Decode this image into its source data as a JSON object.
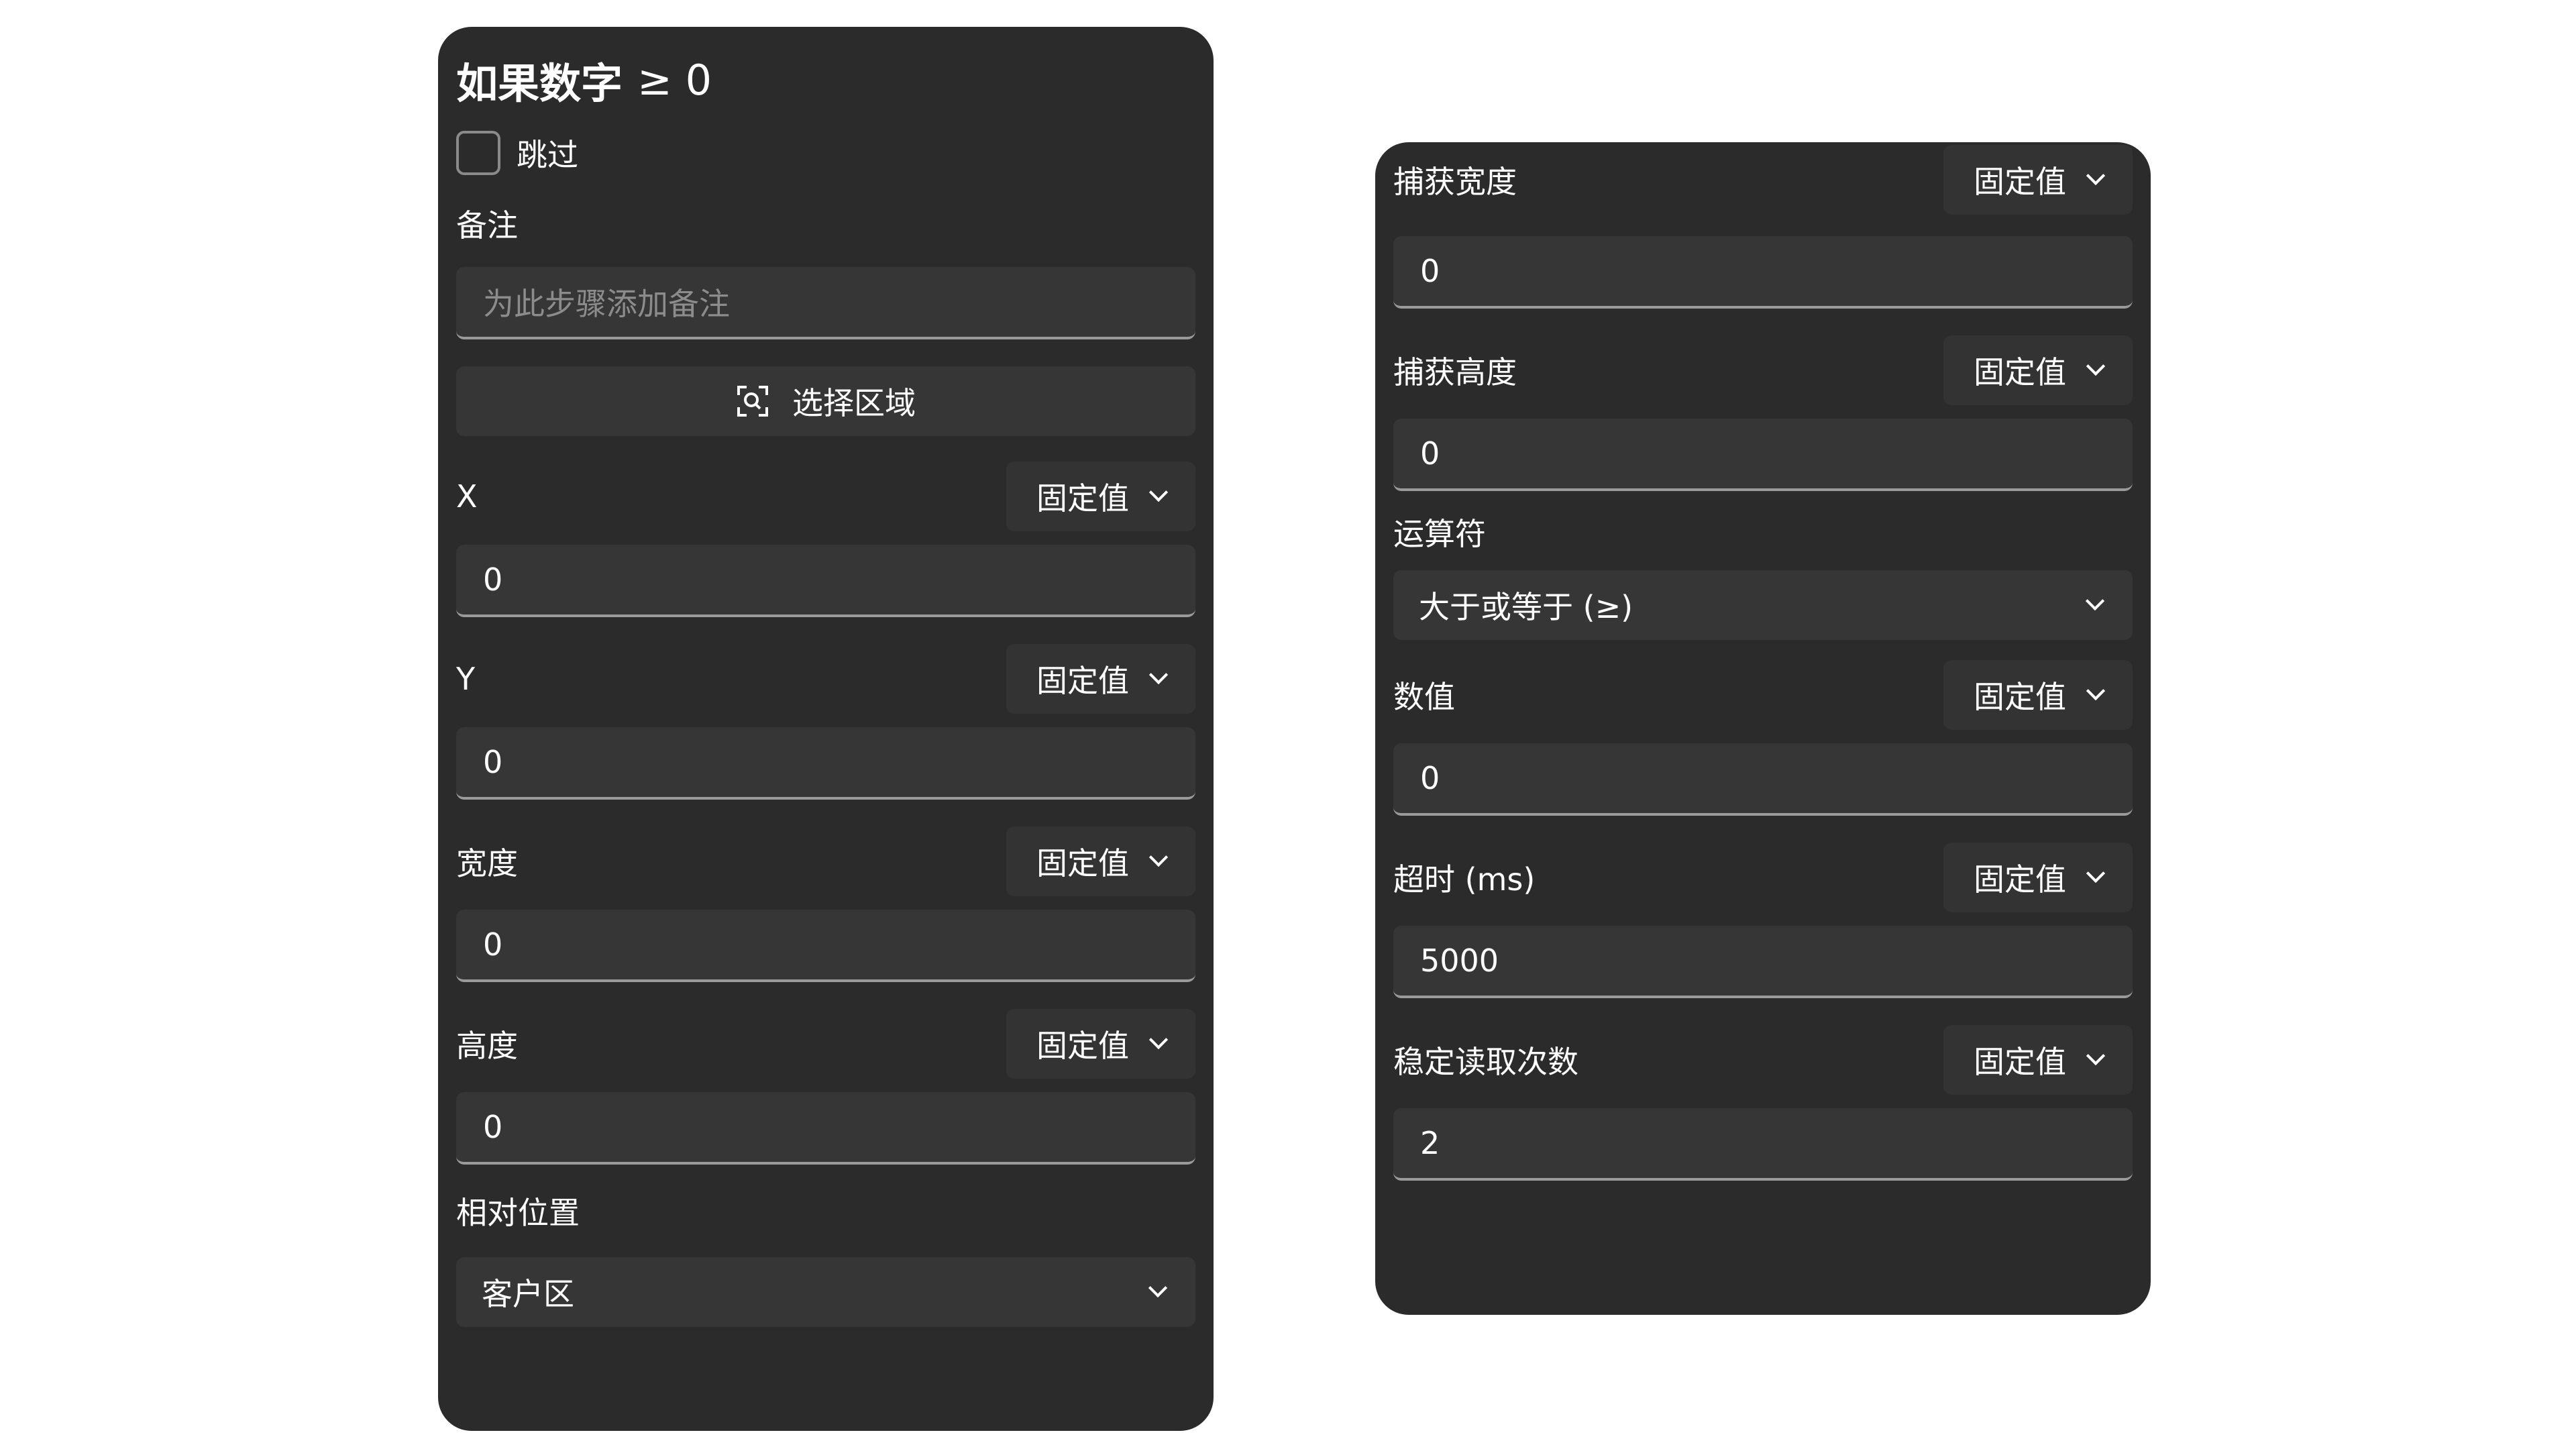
{
  "left_panel": {
    "title": "如果数字",
    "title_operator": "≥ 0",
    "skip_label": "跳过",
    "note_label": "备注",
    "note_placeholder": "为此步骤添加备注",
    "select_region_label": "选择区域",
    "fields": [
      {
        "label": "X",
        "mode": "固定值",
        "value": "0"
      },
      {
        "label": "Y",
        "mode": "固定值",
        "value": "0"
      },
      {
        "label": "宽度",
        "mode": "固定值",
        "value": "0"
      },
      {
        "label": "高度",
        "mode": "固定值",
        "value": "0"
      }
    ],
    "relative_position_label": "相对位置",
    "relative_position_value": "客户区"
  },
  "right_panel": {
    "fields_top": [
      {
        "label": "捕获宽度",
        "mode": "固定值",
        "value": "0"
      },
      {
        "label": "捕获高度",
        "mode": "固定值",
        "value": "0"
      }
    ],
    "operator_label": "运算符",
    "operator_value": "大于或等于 (≥)",
    "fields_bottom": [
      {
        "label": "数值",
        "mode": "固定值",
        "value": "0"
      },
      {
        "label": "超时 (ms)",
        "mode": "固定值",
        "value": "5000"
      },
      {
        "label": "稳定读取次数",
        "mode": "固定值",
        "value": "2"
      }
    ]
  }
}
